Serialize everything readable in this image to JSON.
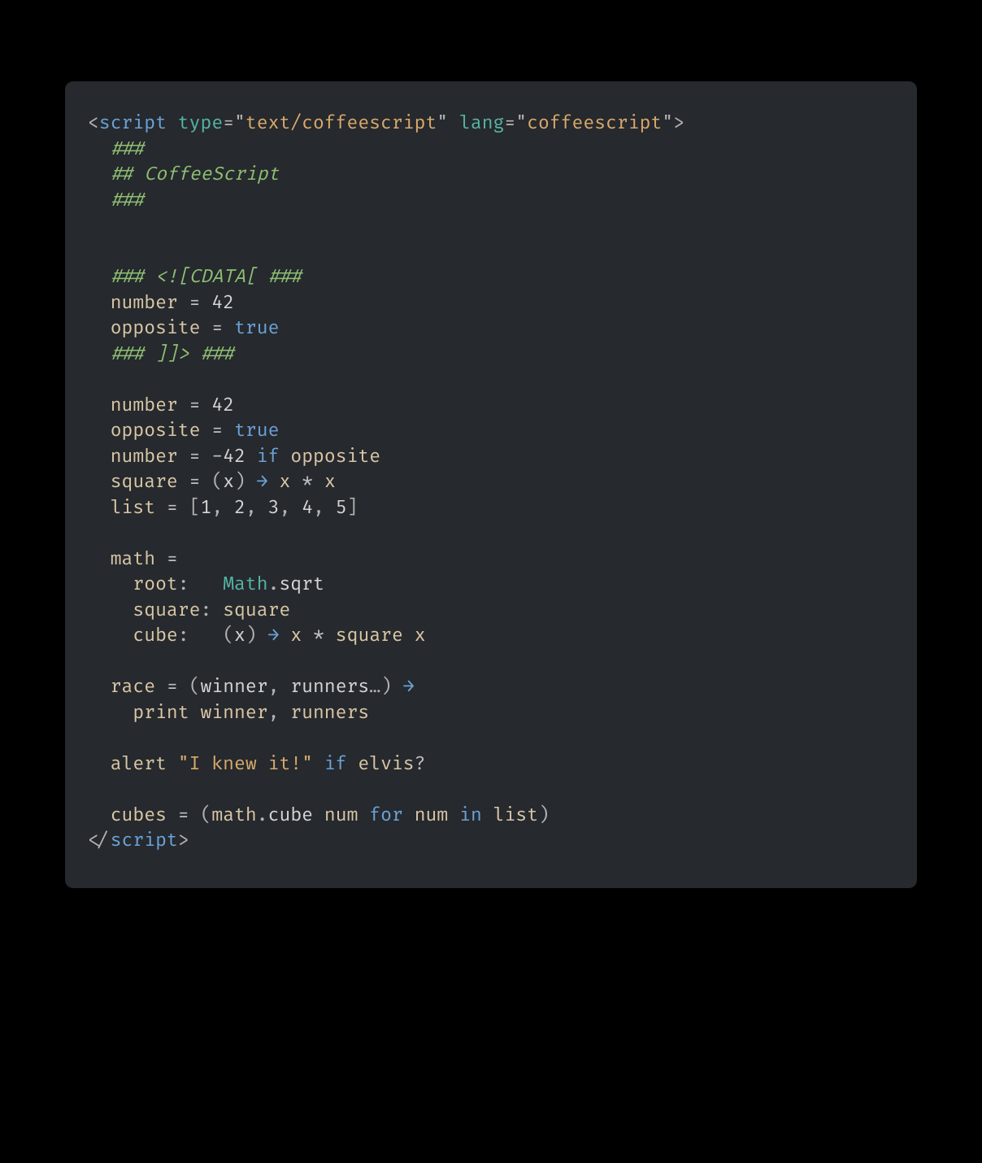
{
  "code": {
    "tokens": [
      [
        {
          "c": "t-pun",
          "t": "<"
        },
        {
          "c": "t-tag",
          "t": "script"
        },
        {
          "c": "",
          "t": " "
        },
        {
          "c": "t-attr",
          "t": "type"
        },
        {
          "c": "t-pun",
          "t": "="
        },
        {
          "c": "t-pun",
          "t": "\""
        },
        {
          "c": "t-str",
          "t": "text/coffeescript"
        },
        {
          "c": "t-pun",
          "t": "\""
        },
        {
          "c": "",
          "t": " "
        },
        {
          "c": "t-attr",
          "t": "lang"
        },
        {
          "c": "t-pun",
          "t": "="
        },
        {
          "c": "t-pun",
          "t": "\""
        },
        {
          "c": "t-str",
          "t": "coffeescript"
        },
        {
          "c": "t-pun",
          "t": "\""
        },
        {
          "c": "t-pun",
          "t": ">"
        }
      ],
      [
        {
          "c": "",
          "t": "  "
        },
        {
          "c": "t-cmt",
          "t": "###"
        }
      ],
      [
        {
          "c": "",
          "t": "  "
        },
        {
          "c": "t-cmt",
          "t": "## CoffeeScript"
        }
      ],
      [
        {
          "c": "",
          "t": "  "
        },
        {
          "c": "t-cmt",
          "t": "###"
        }
      ],
      [],
      [],
      [
        {
          "c": "",
          "t": "  "
        },
        {
          "c": "t-cmt",
          "t": "### <![CDATA[ ###"
        }
      ],
      [
        {
          "c": "",
          "t": "  "
        },
        {
          "c": "t-var",
          "t": "number"
        },
        {
          "c": "",
          "t": " "
        },
        {
          "c": "t-op",
          "t": "="
        },
        {
          "c": "",
          "t": " "
        },
        {
          "c": "t-num",
          "t": "42"
        }
      ],
      [
        {
          "c": "",
          "t": "  "
        },
        {
          "c": "t-var",
          "t": "opposite"
        },
        {
          "c": "",
          "t": " "
        },
        {
          "c": "t-op",
          "t": "="
        },
        {
          "c": "",
          "t": " "
        },
        {
          "c": "t-kw",
          "t": "true"
        }
      ],
      [
        {
          "c": "",
          "t": "  "
        },
        {
          "c": "t-cmt",
          "t": "### ]]> ###"
        }
      ],
      [],
      [
        {
          "c": "",
          "t": "  "
        },
        {
          "c": "t-var",
          "t": "number"
        },
        {
          "c": "",
          "t": " "
        },
        {
          "c": "t-op",
          "t": "="
        },
        {
          "c": "",
          "t": " "
        },
        {
          "c": "t-num",
          "t": "42"
        }
      ],
      [
        {
          "c": "",
          "t": "  "
        },
        {
          "c": "t-var",
          "t": "opposite"
        },
        {
          "c": "",
          "t": " "
        },
        {
          "c": "t-op",
          "t": "="
        },
        {
          "c": "",
          "t": " "
        },
        {
          "c": "t-kw",
          "t": "true"
        }
      ],
      [
        {
          "c": "",
          "t": "  "
        },
        {
          "c": "t-var",
          "t": "number"
        },
        {
          "c": "",
          "t": " "
        },
        {
          "c": "t-op",
          "t": "="
        },
        {
          "c": "",
          "t": " "
        },
        {
          "c": "t-op",
          "t": "-"
        },
        {
          "c": "t-num",
          "t": "42"
        },
        {
          "c": "",
          "t": " "
        },
        {
          "c": "t-kw",
          "t": "if"
        },
        {
          "c": "",
          "t": " "
        },
        {
          "c": "t-var",
          "t": "opposite"
        }
      ],
      [
        {
          "c": "",
          "t": "  "
        },
        {
          "c": "t-var",
          "t": "square"
        },
        {
          "c": "",
          "t": " "
        },
        {
          "c": "t-op",
          "t": "="
        },
        {
          "c": "",
          "t": " "
        },
        {
          "c": "t-pun",
          "t": "("
        },
        {
          "c": "t-param",
          "t": "x"
        },
        {
          "c": "t-pun",
          "t": ")"
        },
        {
          "c": "",
          "t": " "
        },
        {
          "c": "t-fn",
          "t": "→"
        },
        {
          "c": "",
          "t": " "
        },
        {
          "c": "t-var",
          "t": "x"
        },
        {
          "c": "",
          "t": " "
        },
        {
          "c": "t-op",
          "t": "*"
        },
        {
          "c": "",
          "t": " "
        },
        {
          "c": "t-var",
          "t": "x"
        }
      ],
      [
        {
          "c": "",
          "t": "  "
        },
        {
          "c": "t-var",
          "t": "list"
        },
        {
          "c": "",
          "t": " "
        },
        {
          "c": "t-op",
          "t": "="
        },
        {
          "c": "",
          "t": " "
        },
        {
          "c": "t-pun",
          "t": "["
        },
        {
          "c": "t-num",
          "t": "1"
        },
        {
          "c": "t-pun",
          "t": ", "
        },
        {
          "c": "t-num",
          "t": "2"
        },
        {
          "c": "t-pun",
          "t": ", "
        },
        {
          "c": "t-num",
          "t": "3"
        },
        {
          "c": "t-pun",
          "t": ", "
        },
        {
          "c": "t-num",
          "t": "4"
        },
        {
          "c": "t-pun",
          "t": ", "
        },
        {
          "c": "t-num",
          "t": "5"
        },
        {
          "c": "t-pun",
          "t": "]"
        }
      ],
      [],
      [
        {
          "c": "",
          "t": "  "
        },
        {
          "c": "t-var",
          "t": "math"
        },
        {
          "c": "",
          "t": " "
        },
        {
          "c": "t-op",
          "t": "="
        }
      ],
      [
        {
          "c": "",
          "t": "    "
        },
        {
          "c": "t-var",
          "t": "root"
        },
        {
          "c": "t-pun",
          "t": ":"
        },
        {
          "c": "",
          "t": "   "
        },
        {
          "c": "t-class",
          "t": "Math"
        },
        {
          "c": "t-pun",
          "t": "."
        },
        {
          "c": "t-call",
          "t": "sqrt"
        }
      ],
      [
        {
          "c": "",
          "t": "    "
        },
        {
          "c": "t-var",
          "t": "square"
        },
        {
          "c": "t-pun",
          "t": ":"
        },
        {
          "c": "",
          "t": " "
        },
        {
          "c": "t-var",
          "t": "square"
        }
      ],
      [
        {
          "c": "",
          "t": "    "
        },
        {
          "c": "t-var",
          "t": "cube"
        },
        {
          "c": "t-pun",
          "t": ":"
        },
        {
          "c": "",
          "t": "   "
        },
        {
          "c": "t-pun",
          "t": "("
        },
        {
          "c": "t-param",
          "t": "x"
        },
        {
          "c": "t-pun",
          "t": ")"
        },
        {
          "c": "",
          "t": " "
        },
        {
          "c": "t-fn",
          "t": "→"
        },
        {
          "c": "",
          "t": " "
        },
        {
          "c": "t-var",
          "t": "x"
        },
        {
          "c": "",
          "t": " "
        },
        {
          "c": "t-op",
          "t": "*"
        },
        {
          "c": "",
          "t": " "
        },
        {
          "c": "t-var",
          "t": "square"
        },
        {
          "c": "",
          "t": " "
        },
        {
          "c": "t-var",
          "t": "x"
        }
      ],
      [],
      [
        {
          "c": "",
          "t": "  "
        },
        {
          "c": "t-var",
          "t": "race"
        },
        {
          "c": "",
          "t": " "
        },
        {
          "c": "t-op",
          "t": "="
        },
        {
          "c": "",
          "t": " "
        },
        {
          "c": "t-pun",
          "t": "("
        },
        {
          "c": "t-param",
          "t": "winner"
        },
        {
          "c": "t-pun",
          "t": ", "
        },
        {
          "c": "t-param",
          "t": "runners"
        },
        {
          "c": "t-pun",
          "t": "…"
        },
        {
          "c": "t-pun",
          "t": ")"
        },
        {
          "c": "",
          "t": " "
        },
        {
          "c": "t-fn",
          "t": "→"
        }
      ],
      [
        {
          "c": "",
          "t": "    "
        },
        {
          "c": "t-var",
          "t": "print"
        },
        {
          "c": "",
          "t": " "
        },
        {
          "c": "t-var",
          "t": "winner"
        },
        {
          "c": "t-pun",
          "t": ", "
        },
        {
          "c": "t-var",
          "t": "runners"
        }
      ],
      [],
      [
        {
          "c": "",
          "t": "  "
        },
        {
          "c": "t-var",
          "t": "alert"
        },
        {
          "c": "",
          "t": " "
        },
        {
          "c": "t-str",
          "t": "\"I knew it!\""
        },
        {
          "c": "",
          "t": " "
        },
        {
          "c": "t-kw",
          "t": "if"
        },
        {
          "c": "",
          "t": " "
        },
        {
          "c": "t-var",
          "t": "elvis"
        },
        {
          "c": "t-op",
          "t": "?"
        }
      ],
      [],
      [
        {
          "c": "",
          "t": "  "
        },
        {
          "c": "t-var",
          "t": "cubes"
        },
        {
          "c": "",
          "t": " "
        },
        {
          "c": "t-op",
          "t": "="
        },
        {
          "c": "",
          "t": " "
        },
        {
          "c": "t-pun",
          "t": "("
        },
        {
          "c": "t-var",
          "t": "math"
        },
        {
          "c": "t-pun",
          "t": "."
        },
        {
          "c": "t-call",
          "t": "cube"
        },
        {
          "c": "",
          "t": " "
        },
        {
          "c": "t-var",
          "t": "num"
        },
        {
          "c": "",
          "t": " "
        },
        {
          "c": "t-kw",
          "t": "for"
        },
        {
          "c": "",
          "t": " "
        },
        {
          "c": "t-var",
          "t": "num"
        },
        {
          "c": "",
          "t": " "
        },
        {
          "c": "t-kw",
          "t": "in"
        },
        {
          "c": "",
          "t": " "
        },
        {
          "c": "t-var",
          "t": "list"
        },
        {
          "c": "t-pun",
          "t": ")"
        }
      ],
      [
        {
          "c": "t-pun",
          "t": "</"
        },
        {
          "c": "t-tag",
          "t": "script"
        },
        {
          "c": "t-pun",
          "t": ">"
        }
      ]
    ]
  }
}
